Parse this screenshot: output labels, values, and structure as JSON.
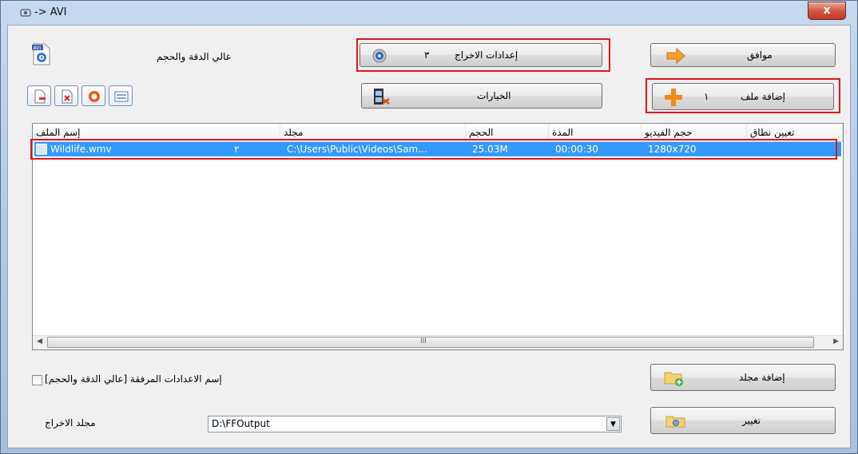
{
  "window": {
    "title": "-> AVI",
    "close_glyph": "x"
  },
  "preset": {
    "quality_label": "عالي الدقة والحجم",
    "icon": "avi-file-icon"
  },
  "buttons": {
    "ok": "موافق",
    "output_settings": "إعدادات الاخراج",
    "output_settings_marker": "٣",
    "options": "الخيارات",
    "add_file": "إضافة ملف",
    "add_file_marker": "١",
    "add_folder": "إضافة مجلد",
    "change": "تغيير"
  },
  "list": {
    "columns": [
      "إسم الملف",
      "مجلد",
      "الحجم",
      "المدة",
      "حجم الفيديو",
      "تعيين نطاق"
    ],
    "rows": [
      {
        "name": "Wildlife.wmv",
        "marker": "٢",
        "folder": "C:\\Users\\Public\\Videos\\Sam...",
        "size": "25.03M",
        "duration": "00:00:30",
        "video_size": "1280x720",
        "range": ""
      }
    ],
    "scroll_grip": "III"
  },
  "options": {
    "append_setting_name": "[إسم الاعدادات المرفقة [عالي الدقة والحجم",
    "append_setting_checked": false
  },
  "output": {
    "label": "مجلد الاخراج",
    "folder": "D:\\FFOutput"
  },
  "colors": {
    "selection": "#3399ff",
    "highlight_box": "#e0141b",
    "close_button": "#c8402c"
  }
}
